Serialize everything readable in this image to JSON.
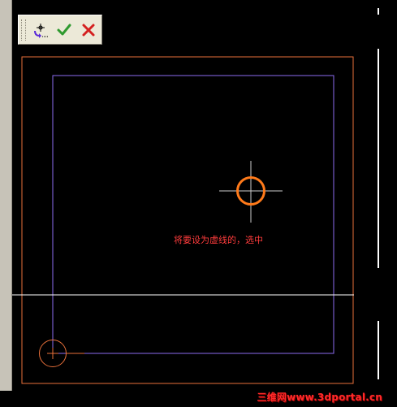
{
  "toolbar": {
    "buttons": [
      {
        "name": "pick-icon",
        "color": "#5a2bd8"
      },
      {
        "name": "confirm-check-icon",
        "color": "#3aa53a"
      },
      {
        "name": "cancel-x-icon",
        "color": "#d42020"
      }
    ]
  },
  "canvas": {
    "background": "#000000",
    "hint_text": "将要设为虚线的，选中",
    "outer_rect_color": "#e8703a",
    "inner_rect_color": "#8c6cf0",
    "highlight_circle_color": "#ff7a1a",
    "axis_color": "#ffffff",
    "small_circle_color": "#e8703a"
  },
  "watermark": {
    "text": "三维网www.3dportal.cn"
  }
}
